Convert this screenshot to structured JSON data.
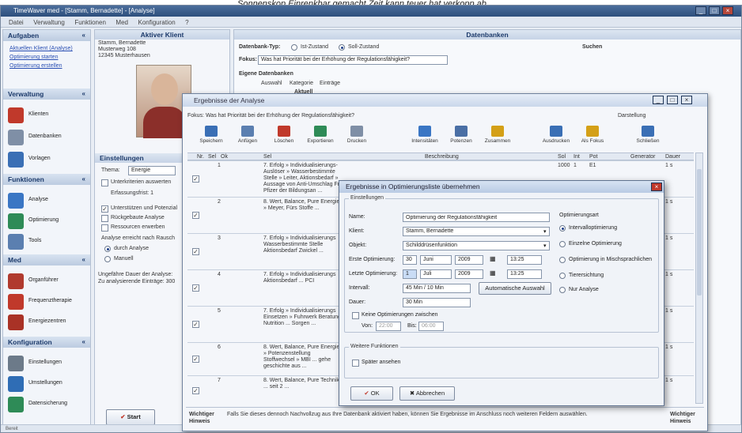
{
  "caption": "Sonnenskop Einrenkbar gemacht Zeit kann teuer hat verkopp ab",
  "window": {
    "title": "TimeWaver med - [Stamm, Bernadette] - [Analyse]",
    "menu": [
      "Datei",
      "Verwaltung",
      "Funktionen",
      "Med",
      "Konfiguration",
      "?"
    ]
  },
  "nav": {
    "sections": [
      {
        "title": "Aufgaben",
        "links": [
          "Aktuellen Klient (Analyse)",
          "Optimierung starten",
          "Optimierung erstellen"
        ]
      },
      {
        "title": "Verwaltung",
        "items": [
          "Klienten",
          "Datenbanken",
          "Vorlagen"
        ]
      },
      {
        "title": "Funktionen",
        "items": [
          "Analyse",
          "Optimierung",
          "Tools"
        ]
      },
      {
        "title": "Med",
        "items": [
          "Organführer",
          "Frequenztherapie",
          "Energiezentren"
        ]
      },
      {
        "title": "Konfiguration",
        "items": [
          "Einstellungen",
          "Umstellungen",
          "Datensicherung"
        ]
      }
    ]
  },
  "client": {
    "header": "Aktiver Klient",
    "name": "Stamm, Bernadette",
    "street": "Musterweg 108",
    "city": "12345 Musterhausen",
    "settings_header": "Einstellungen",
    "theme_label": "Thema:",
    "theme_value": "Energie",
    "options": [
      "Unterkriterien auswerten",
      "Erfassungsfrist: 1",
      "Unterstützen und Potenzial",
      "Rückgebaute Analyse",
      "Ressourcen erwerben"
    ],
    "analysis_label": "Analyse erreicht nach Rausch",
    "radio_auto": "durch Analyse",
    "radio_manual": "Manuell",
    "duration_label": "Ungefähre Dauer der Analyse:",
    "rating_label": "Zu analysierende Einträge: 300",
    "start_button": "Start"
  },
  "db": {
    "header": "Datenbanken",
    "db_type_label": "Datenbank-Typ:",
    "db_type_option1": "Ist-Zustand",
    "db_type_option2": "Soll-Zustand",
    "search_label": "Suchen",
    "focus_label": "Fokus:",
    "focus_text": "Was hat Priorität bei der Erhöhung der Regulationsfähigkeit?",
    "own_db_label": "Eigene Datenbanken",
    "cols": [
      "Auswahl",
      "Kategorie",
      "Einträge"
    ],
    "row1": "Aktuell"
  },
  "results": {
    "title": "Ergebnisse der Analyse",
    "focus": "Fokus: Was hat Priorität bei der Erhöhung der Regulationsfähigkeit?",
    "display_label": "Darstellung",
    "toolbar": [
      "Speichern",
      "Anfügen",
      "Löschen",
      "Exportieren",
      "Drucken",
      "Intensitäten",
      "Potenzen",
      "Zusammen",
      "Ausdrucken",
      "Als Fokus",
      "Schließen"
    ],
    "columns": [
      "Nr.",
      "Sel",
      "Ok",
      "Sel",
      "Beschreibung",
      "Sol",
      "Int",
      "Pot",
      "Generator",
      "Dauer"
    ],
    "rows": [
      {
        "nr": "1",
        "text": "7. Erfolg » Individualisierungs-Auslöser » Wasserbestimmte Stelle » Leiter, Aktionsbedarf » Aussage von Anti-Umschlag Franz Pfizer der Bildungsan ...",
        "sol": "1000",
        "int": "1",
        "pot": "E1",
        "dur": "1 s"
      },
      {
        "nr": "2",
        "text": "8. Wert, Balance, Pure Energie » Meyer, Fürs Stoffe ...",
        "dur": "1 s"
      },
      {
        "nr": "3",
        "text": "7. Erfolg » Individualisierungs Wasserbestimmte Stelle Aktionsbedarf Zwickel ...",
        "dur": "1 s"
      },
      {
        "nr": "4",
        "text": "7. Erfolg » Individualisierungs Aktionsbedarf ... PCI",
        "dur": "1 s"
      },
      {
        "nr": "5",
        "text": "7. Erfolg » Individualisierungs Einsetzen » Fuhrwerk Beratung, Nutrition ... Sorgen ...",
        "dur": "1 s"
      },
      {
        "nr": "6",
        "text": "8. Wert, Balance, Pure Energie » Potenzenstellung Stoffwechsel » MBI ... gehe geschichte aus ...",
        "dur": "1 s"
      },
      {
        "nr": "7",
        "text": "8. Wert, Balance, Pure Technik ... seit 2 ...",
        "dur": "1 s"
      }
    ],
    "footer_note_title": "Wichtiger Hinweis",
    "footer_note": "Falls Sie dieses dennoch Nachvollzug aus Ihre Datenbank aktiviert haben, können Sie Ergebnisse im Anschluss noch weiteren Feldern auswählen.",
    "footer_note_title_right": "Wichtiger Hinweis"
  },
  "opt": {
    "title": "Ergebnisse in Optimierungsliste übernehmen",
    "settings_group": "Einstellungen",
    "name_label": "Name:",
    "name_value": "Optimierung der Regulationsfähigkeit",
    "client_label": "Klient:",
    "client_value": "Stamm, Bernadette",
    "object_label": "Objekt:",
    "object_value": "Schilddrüsenfunktion",
    "first_label": "Erste Optimierung:",
    "first_day": "30",
    "first_month": "Juni",
    "first_year": "2009",
    "first_time": "13:25",
    "last_label": "Letzte Optimierung:",
    "last_day": "1",
    "last_month": "Juli",
    "last_year": "2009",
    "last_time": "13:25",
    "interval_label": "Intervall:",
    "interval_value": "45 Min / 10 Min",
    "auto_button": "Automatische Auswahl",
    "duration_label": "Dauer:",
    "duration_value": "30 Min",
    "no_opt_check": "Keine Optimierungen zwischen",
    "from_label": "Von:",
    "from_value": "22:00",
    "to_label": "Bis:",
    "to_value": "06:00",
    "further_group": "Weitere Funktionen",
    "later_check": "Später ansehen",
    "type_group": "Optimierungsart",
    "types": [
      "Intervalloptimierung",
      "Einzelne Optimierung",
      "Optimierung in Mischsprachlichen",
      "Tierersichtung",
      "Nur Analyse"
    ],
    "ok_button": "OK",
    "cancel_button": "Abbrechen"
  },
  "status": "Bereit",
  "colors": {
    "accent": "#2d4f7c",
    "cancel_red": "#c0392b",
    "check_red": "#c0392b"
  }
}
